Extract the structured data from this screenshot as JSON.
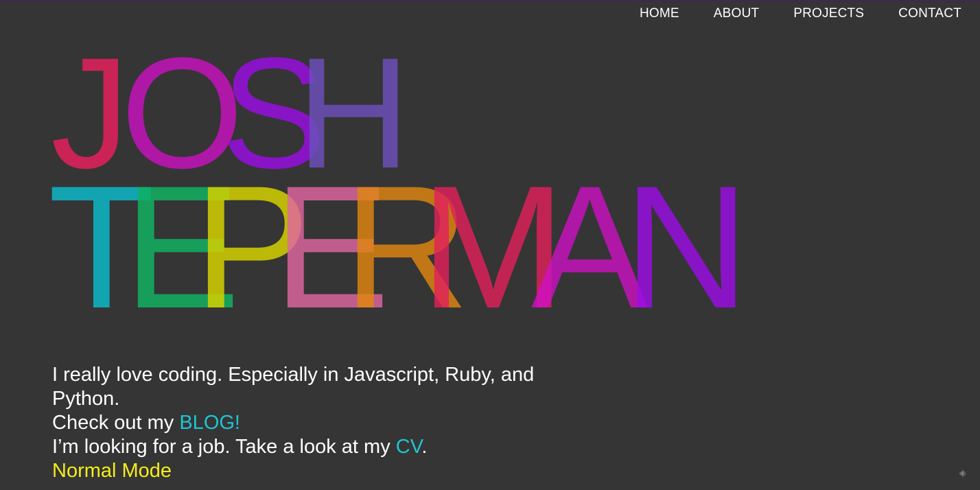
{
  "nav": {
    "items": [
      {
        "label": "HOME"
      },
      {
        "label": "ABOUT"
      },
      {
        "label": "PROJECTS"
      },
      {
        "label": "CONTACT"
      }
    ]
  },
  "hero": {
    "first_name": [
      "J",
      "O",
      "S",
      "H"
    ],
    "last_name": [
      "T",
      "E",
      "P",
      "E",
      "R",
      "M",
      "A",
      "N"
    ],
    "colors": {
      "J": "#e0215a",
      "O": "#d20fc8",
      "S": "#9b0ee6",
      "H": "#6b4fb8",
      "T": "#0fb4c4",
      "E1": "#10b060",
      "P": "#d4d000",
      "E2": "#e066a0",
      "R": "#e08610",
      "M": "#e0215a",
      "A": "#d20fc8",
      "N": "#9b0ee6"
    }
  },
  "intro": {
    "line1": "I really love coding. Especially in Javascript, Ruby, and Python.",
    "line2_prefix": "Check out my ",
    "blog_link": "BLOG!",
    "line3_prefix": "I’m looking for a job. Take a look at my ",
    "cv_link": "CV",
    "line3_suffix": ".",
    "mode_toggle": "Normal Mode"
  },
  "theme": {
    "background": "#353535",
    "link": "#1fc4d4",
    "mode": "#f4ee1a"
  }
}
